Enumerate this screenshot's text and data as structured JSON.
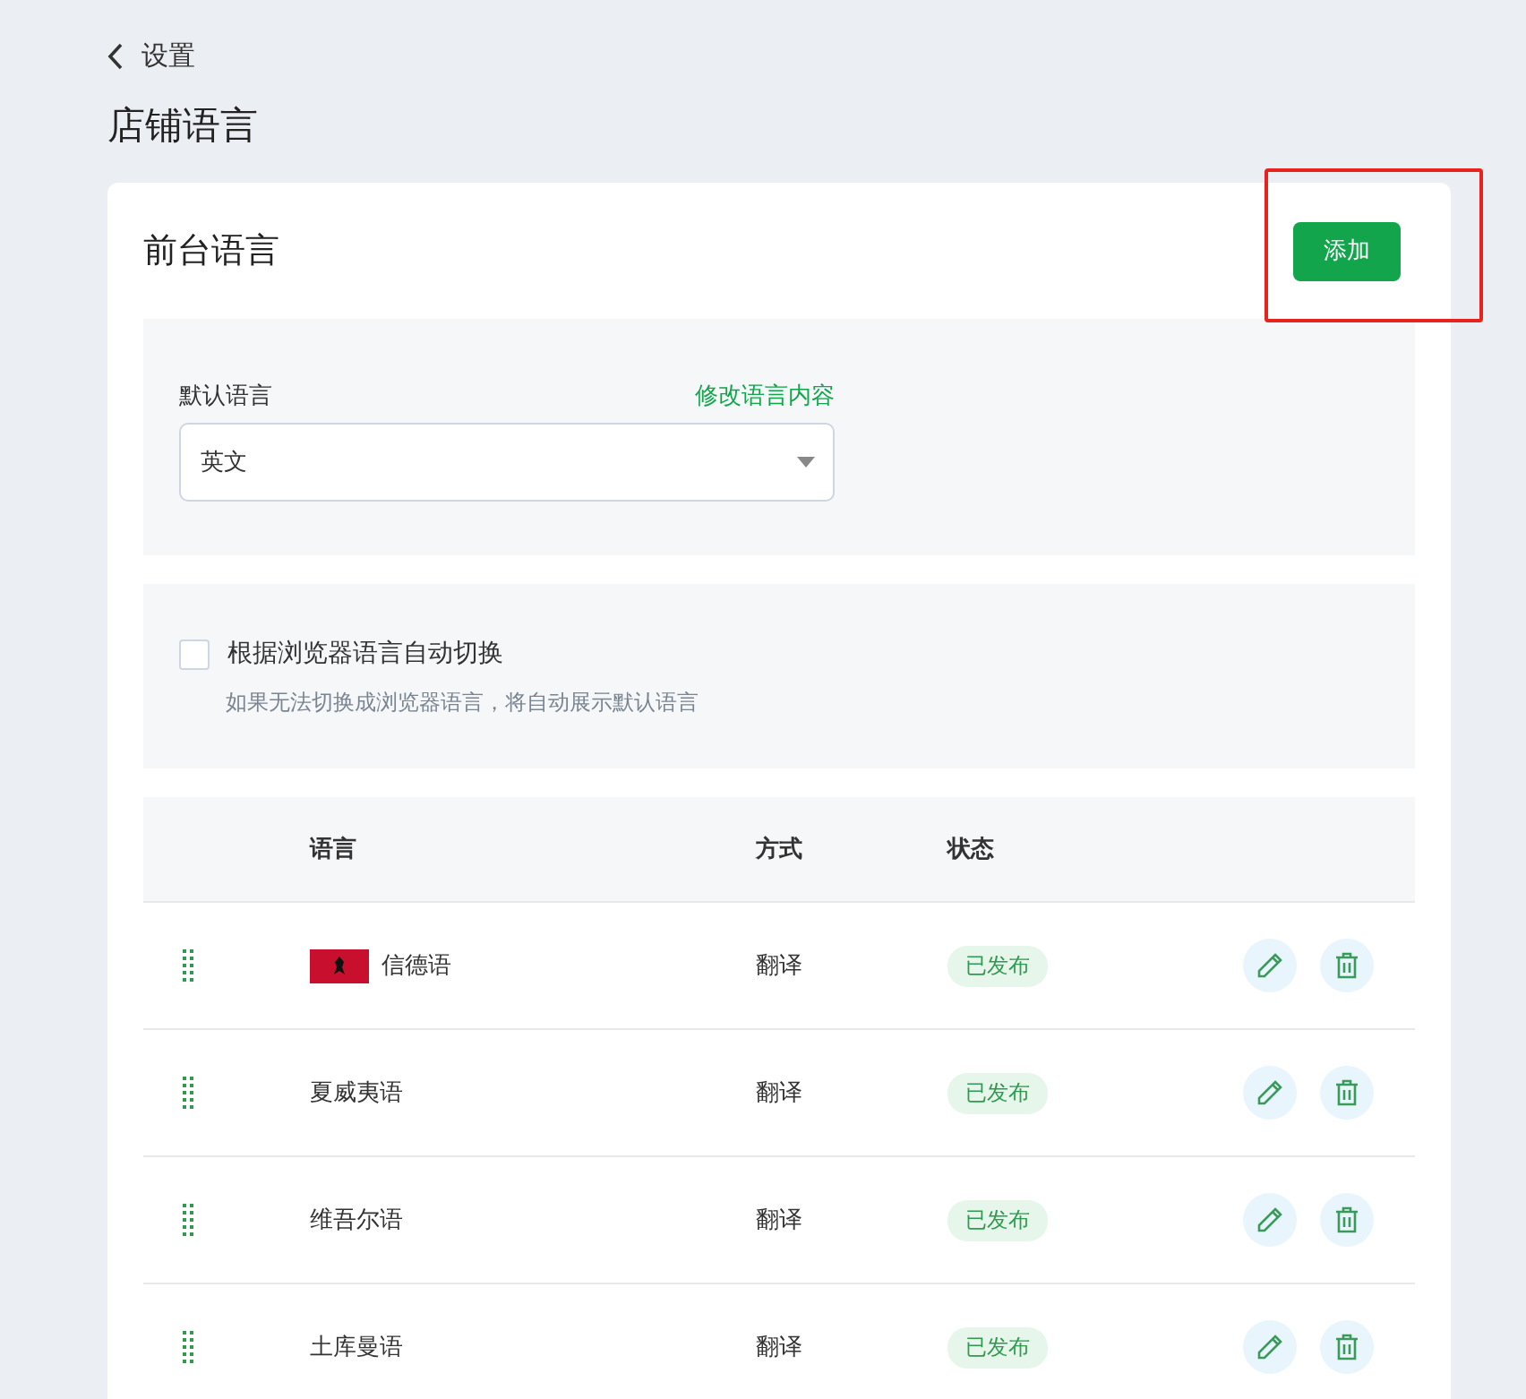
{
  "breadcrumb": {
    "back_label": "设置"
  },
  "page_title": "店铺语言",
  "card": {
    "title": "前台语言",
    "add_button": "添加",
    "highlighted": true
  },
  "default_language": {
    "label": "默认语言",
    "link": "修改语言内容",
    "value": "英文"
  },
  "auto_switch": {
    "label": "根据浏览器语言自动切换",
    "hint": "如果无法切换成浏览器语言，将自动展示默认语言",
    "checked": false
  },
  "table": {
    "columns": [
      "语言",
      "方式",
      "状态"
    ],
    "rows": [
      {
        "language": "信德语",
        "flag": true,
        "method": "翻译",
        "status": "已发布"
      },
      {
        "language": "夏威夷语",
        "flag": false,
        "method": "翻译",
        "status": "已发布"
      },
      {
        "language": "维吾尔语",
        "flag": false,
        "method": "翻译",
        "status": "已发布"
      },
      {
        "language": "土库曼语",
        "flag": false,
        "method": "翻译",
        "status": "已发布"
      }
    ]
  }
}
